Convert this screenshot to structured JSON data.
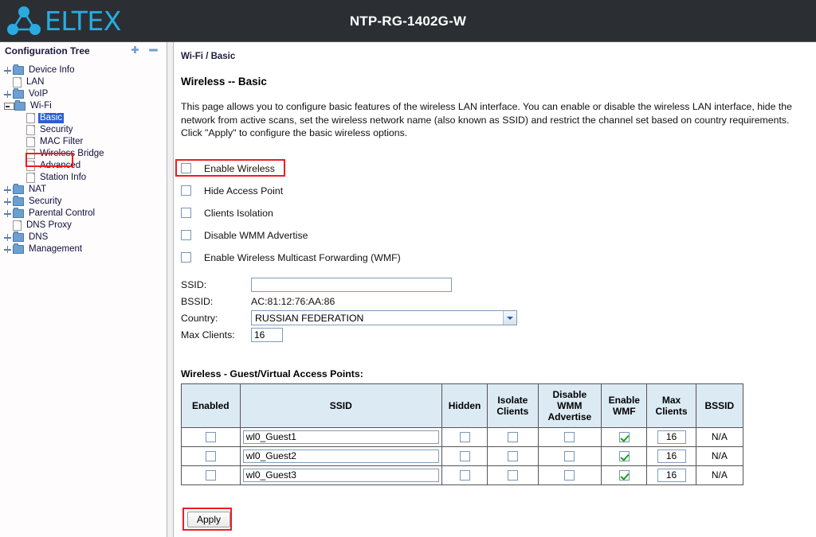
{
  "header": {
    "brand": "ELTEX",
    "logo_color": "#29abe2",
    "title": "NTP-RG-1402G-W",
    "background": "#2b2f33"
  },
  "sidebar": {
    "title": "Configuration Tree",
    "expand_all_icon": "plus-icon",
    "collapse_all_icon": "minus-icon",
    "items": [
      {
        "label": "Device Info",
        "icon": "folder-icon",
        "toggle": "plus",
        "level": 1,
        "selected": false
      },
      {
        "label": "LAN",
        "icon": "page-icon",
        "toggle": "none",
        "level": 1,
        "selected": false
      },
      {
        "label": "VoIP",
        "icon": "folder-icon",
        "toggle": "plus",
        "level": 1,
        "selected": false
      },
      {
        "label": "Wi-Fi",
        "icon": "folder-icon",
        "toggle": "minus",
        "level": 1,
        "selected": false
      },
      {
        "label": "Basic",
        "icon": "page-icon",
        "toggle": "none",
        "level": 2,
        "selected": true
      },
      {
        "label": "Security",
        "icon": "page-icon",
        "toggle": "none",
        "level": 2,
        "selected": false
      },
      {
        "label": "MAC Filter",
        "icon": "page-icon",
        "toggle": "none",
        "level": 2,
        "selected": false
      },
      {
        "label": "Wireless Bridge",
        "icon": "page-icon",
        "toggle": "none",
        "level": 2,
        "selected": false
      },
      {
        "label": "Advanced",
        "icon": "page-icon",
        "toggle": "none",
        "level": 2,
        "selected": false
      },
      {
        "label": "Station Info",
        "icon": "page-icon",
        "toggle": "none",
        "level": 2,
        "selected": false
      },
      {
        "label": "NAT",
        "icon": "folder-icon",
        "toggle": "plus",
        "level": 1,
        "selected": false
      },
      {
        "label": "Security",
        "icon": "folder-icon",
        "toggle": "plus",
        "level": 1,
        "selected": false
      },
      {
        "label": "Parental Control",
        "icon": "folder-icon",
        "toggle": "plus",
        "level": 1,
        "selected": false
      },
      {
        "label": "DNS Proxy",
        "icon": "page-icon",
        "toggle": "none",
        "level": 1,
        "selected": false
      },
      {
        "label": "DNS",
        "icon": "folder-icon",
        "toggle": "plus",
        "level": 1,
        "selected": false
      },
      {
        "label": "Management",
        "icon": "folder-icon",
        "toggle": "plus",
        "level": 1,
        "selected": false
      }
    ]
  },
  "main": {
    "breadcrumb": "Wi-Fi / Basic",
    "page_title": "Wireless -- Basic",
    "description_line1": "This page allows you to configure basic features of the wireless LAN interface. You can enable or disable the wireless LAN interface,",
    "description_line2": "hide the network from active scans, set the wireless network name (also known as SSID) and restrict the channel set based on",
    "description_line3": "country requirements.",
    "description_line4": "Click \"Apply\" to configure the basic wireless options.",
    "checkboxes": [
      {
        "label": "Enable Wireless",
        "checked": false,
        "highlighted": true
      },
      {
        "label": "Hide Access Point",
        "checked": false,
        "highlighted": false
      },
      {
        "label": "Clients Isolation",
        "checked": false,
        "highlighted": false
      },
      {
        "label": "Disable WMM Advertise",
        "checked": false,
        "highlighted": false
      },
      {
        "label": "Enable Wireless Multicast Forwarding (WMF)",
        "checked": false,
        "highlighted": false
      }
    ],
    "fields": {
      "ssid_label": "SSID:",
      "ssid_value": "",
      "bssid_label": "BSSID:",
      "bssid_value": "AC:81:12:76:AA:86",
      "country_label": "Country:",
      "country_value": "RUSSIAN FEDERATION",
      "max_clients_label": "Max Clients:",
      "max_clients_value": "16"
    },
    "vap": {
      "title": "Wireless - Guest/Virtual Access Points:",
      "columns": [
        "Enabled",
        "SSID",
        "Hidden",
        "Isolate Clients",
        "Disable WMM Advertise",
        "Enable WMF",
        "Max Clients",
        "BSSID"
      ],
      "rows": [
        {
          "enabled": false,
          "ssid": "wl0_Guest1",
          "hidden": false,
          "isolate": false,
          "disable_wmm": false,
          "enable_wmf": true,
          "max_clients": "16",
          "bssid": "N/A"
        },
        {
          "enabled": false,
          "ssid": "wl0_Guest2",
          "hidden": false,
          "isolate": false,
          "disable_wmm": false,
          "enable_wmf": true,
          "max_clients": "16",
          "bssid": "N/A"
        },
        {
          "enabled": false,
          "ssid": "wl0_Guest3",
          "hidden": false,
          "isolate": false,
          "disable_wmm": false,
          "enable_wmf": true,
          "max_clients": "16",
          "bssid": "N/A"
        }
      ]
    },
    "apply_label": "Apply",
    "highlight_color": "#ee1c22"
  }
}
